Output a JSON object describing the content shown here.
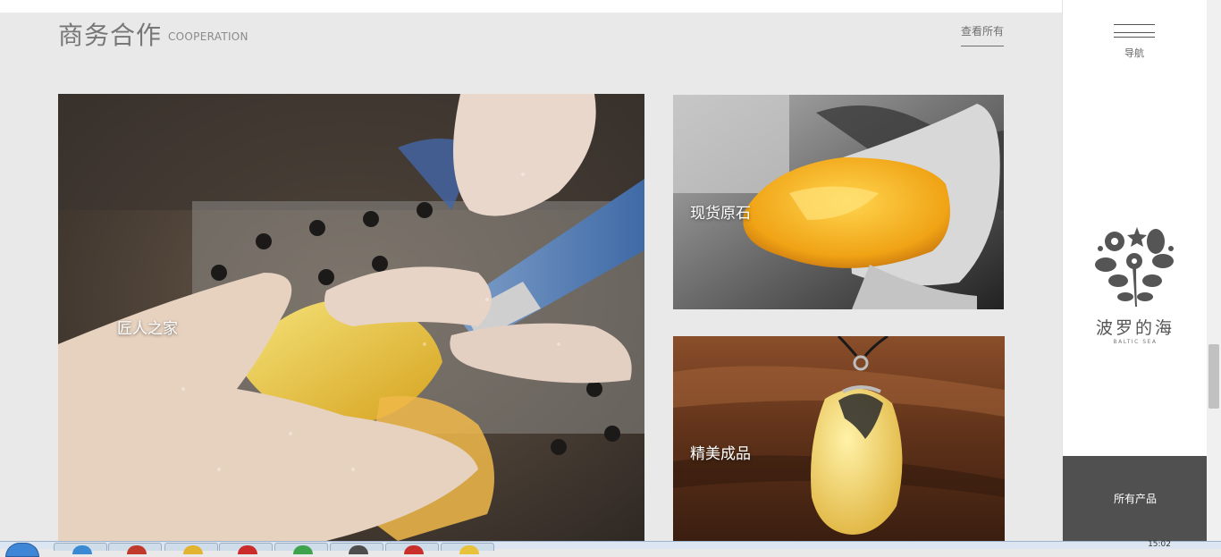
{
  "header": {
    "title": "商务合作",
    "subtitle": "COOPERATION",
    "view_all": "查看所有"
  },
  "tiles": [
    {
      "label": "匠人之家"
    },
    {
      "label": "现货原石"
    },
    {
      "label": "精美成品"
    }
  ],
  "sidebar": {
    "nav_label": "导航",
    "brand_name": "波罗的海",
    "brand_sub": "BALTIC SEA",
    "all_products": "所有产品"
  },
  "taskbar": {
    "clock": "15:02",
    "buttons": [
      {
        "icon": "app-icon",
        "color": "#3a8ad3"
      },
      {
        "icon": "browser-icon",
        "color": "#c0392b"
      },
      {
        "icon": "folder-icon",
        "color": "#e2b42f"
      },
      {
        "icon": "app-icon",
        "color": "#cc2b2b"
      },
      {
        "icon": "app-icon",
        "color": "#3fa34d"
      },
      {
        "icon": "monitor-icon",
        "color": "#4d4d4d"
      },
      {
        "icon": "app-icon",
        "color": "#c9302c"
      },
      {
        "icon": "app-icon",
        "color": "#e8c23a"
      }
    ]
  }
}
